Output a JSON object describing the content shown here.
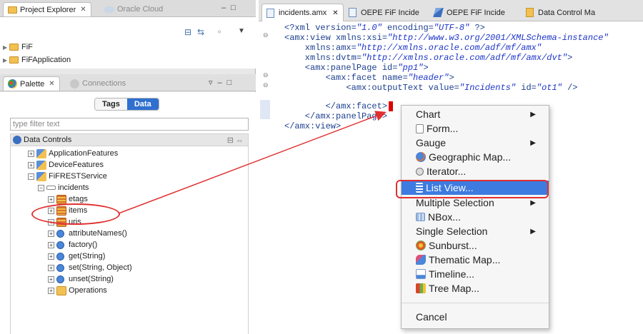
{
  "project_panel": {
    "tabs": [
      {
        "label": "Project Explorer",
        "active": true
      },
      {
        "label": "Oracle Cloud",
        "active": false
      }
    ],
    "tree": [
      "FiF",
      "FiFApplication"
    ]
  },
  "palette_panel": {
    "tabs": [
      {
        "label": "Palette",
        "active": true
      },
      {
        "label": "Connections",
        "active": false
      }
    ],
    "segments": [
      "Tags",
      "Data"
    ],
    "active_segment": "Data",
    "filter_placeholder": "type filter text",
    "data_controls_label": "Data Controls",
    "tree": [
      {
        "label": "ApplicationFeatures",
        "level": 1,
        "icon": "data-control"
      },
      {
        "label": "DeviceFeatures",
        "level": 1,
        "icon": "data-control"
      },
      {
        "label": "FiFRESTService",
        "level": 1,
        "icon": "data-control"
      },
      {
        "label": "incidents",
        "level": 2,
        "icon": "bar"
      },
      {
        "label": "etags",
        "level": 3,
        "icon": "collection"
      },
      {
        "label": "items",
        "level": 3,
        "icon": "collection"
      },
      {
        "label": "uris",
        "level": 3,
        "icon": "collection"
      },
      {
        "label": "attributeNames()",
        "level": 3,
        "icon": "method"
      },
      {
        "label": "factory()",
        "level": 3,
        "icon": "method"
      },
      {
        "label": "get(String)",
        "level": 3,
        "icon": "method"
      },
      {
        "label": "set(String, Object)",
        "level": 3,
        "icon": "method"
      },
      {
        "label": "unset(String)",
        "level": 3,
        "icon": "method"
      },
      {
        "label": "Operations",
        "level": 3,
        "icon": "folder"
      }
    ]
  },
  "editor": {
    "tabs": [
      {
        "label": "incidents.amx",
        "active": true
      },
      {
        "label": "OEPE FiF Incide",
        "active": false
      },
      {
        "label": "OEPE FiF Incide",
        "active": false
      },
      {
        "label": "Data Control Ma",
        "active": false
      }
    ],
    "code": [
      {
        "p1": "<?xml version=",
        "q1": "\"1.0\"",
        "p2": " encoding=",
        "q2": "\"UTF-8\"",
        "p3": " ?>"
      },
      {
        "p1": "<amx:view xmlns:xsi=",
        "q1": "\"http://www.w3.org/2001/XMLSchema-instance\"",
        "p2": "",
        "q2": "",
        "p3": ""
      },
      {
        "p1": "    xmlns:amx=",
        "q1": "\"http://xmlns.oracle.com/adf/mf/amx\"",
        "p2": "",
        "q2": "",
        "p3": ""
      },
      {
        "p1": "    xmlns:dvtm=",
        "q1": "\"http://xmlns.oracle.com/adf/mf/amx/dvt\"",
        "p2": ">",
        "q2": "",
        "p3": ""
      },
      {
        "p1": "    <amx:panelPage id=",
        "q1": "\"pp1\"",
        "p2": ">",
        "q2": "",
        "p3": ""
      },
      {
        "p1": "        <amx:facet name=",
        "q1": "\"header\"",
        "p2": ">",
        "q2": "",
        "p3": ""
      },
      {
        "p1": "            <amx:outputText value=",
        "q1": "\"Incidents\"",
        "p2": " id=",
        "q2": "\"ot1\"",
        "p3": " />"
      },
      {
        "p1": "        </amx:facet>",
        "q1": "",
        "p2": "",
        "q2": "",
        "p3": ""
      },
      {
        "p1": "    </amx:panelPage>",
        "q1": "",
        "p2": "",
        "q2": "",
        "p3": ""
      },
      {
        "p1": "</amx:view>",
        "q1": "",
        "p2": "",
        "q2": "",
        "p3": ""
      }
    ]
  },
  "context_menu": {
    "items": [
      {
        "label": "Chart",
        "submenu": true,
        "icon": ""
      },
      {
        "label": "Form...",
        "submenu": false,
        "icon": "form-icon"
      },
      {
        "label": "Gauge",
        "submenu": true,
        "icon": ""
      },
      {
        "label": "Geographic Map...",
        "submenu": false,
        "icon": "globe-icon"
      },
      {
        "label": "Iterator...",
        "submenu": false,
        "icon": "iterator-icon"
      },
      {
        "label": "List View...",
        "submenu": false,
        "icon": "list-view-icon",
        "selected": true
      },
      {
        "label": "Multiple Selection",
        "submenu": true,
        "icon": ""
      },
      {
        "label": "NBox...",
        "submenu": false,
        "icon": "nbox-icon"
      },
      {
        "label": "Single Selection",
        "submenu": true,
        "icon": ""
      },
      {
        "label": "Sunburst...",
        "submenu": false,
        "icon": "sunburst-icon"
      },
      {
        "label": "Thematic Map...",
        "submenu": false,
        "icon": "thematic-map-icon"
      },
      {
        "label": "Timeline...",
        "submenu": false,
        "icon": "timeline-icon"
      },
      {
        "label": "Tree Map...",
        "submenu": false,
        "icon": "tree-map-icon"
      },
      {
        "label": "Cancel",
        "submenu": false,
        "icon": ""
      }
    ]
  },
  "colors": {
    "highlight_ring": "#e03030",
    "selection_blue": "#3d7be0",
    "string_literal": "#1c34c8",
    "markup": "#1d3f8f"
  }
}
